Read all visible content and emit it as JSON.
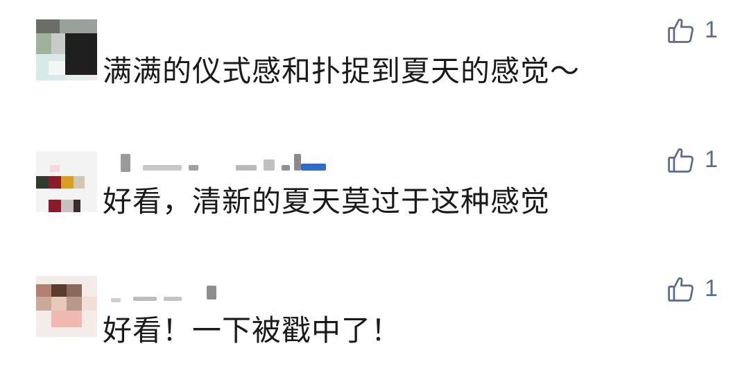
{
  "comments": [
    {
      "avatar_icon": "user-avatar-icon",
      "text": "满满的仪式感和扑捉到夏天的感觉～",
      "like_icon": "thumbs-up-icon",
      "likes": "1"
    },
    {
      "avatar_icon": "user-avatar-icon",
      "text": "好看，清新的夏天莫过于这种感觉",
      "like_icon": "thumbs-up-icon",
      "likes": "1"
    },
    {
      "avatar_icon": "user-avatar-icon",
      "text": "好看！一下被戳中了！",
      "like_icon": "thumbs-up-icon",
      "likes": "1"
    }
  ],
  "colors": {
    "text": "#1a1a1a",
    "like": "#5b6b8c",
    "background": "#ffffff"
  }
}
